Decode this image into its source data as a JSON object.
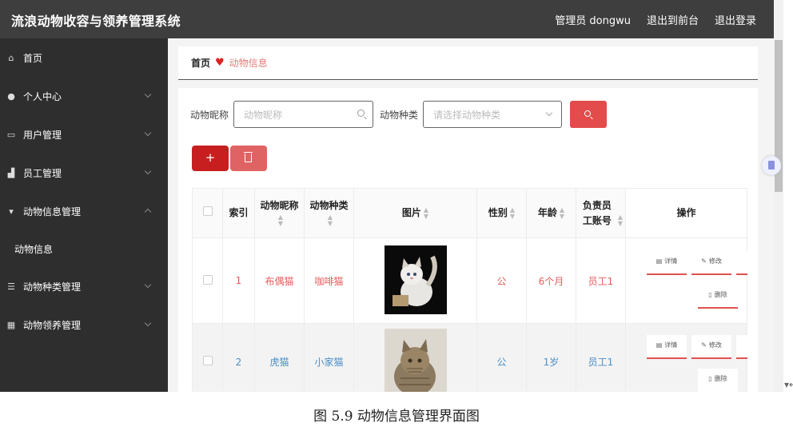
{
  "app": {
    "title": "流浪动物收容与领养管理系统"
  },
  "topbar": {
    "admin": "管理员 dongwu",
    "front": "退出到前台",
    "logout": "退出登录"
  },
  "sidebar": {
    "items": [
      {
        "icon": "home-icon",
        "label": "首页"
      },
      {
        "icon": "user-icon",
        "label": "个人中心"
      },
      {
        "icon": "user-manage-icon",
        "label": "用户管理"
      },
      {
        "icon": "staff-icon",
        "label": "员工管理"
      },
      {
        "icon": "animal-info-icon",
        "label": "动物信息管理"
      },
      {
        "icon": "",
        "label": "动物信息"
      },
      {
        "icon": "category-icon",
        "label": "动物种类管理"
      },
      {
        "icon": "grid-icon",
        "label": "动物领养管理"
      }
    ]
  },
  "breadcrumb": {
    "home": "首页",
    "current": "动物信息"
  },
  "search": {
    "name_label": "动物昵称",
    "name_placeholder": "动物昵称",
    "type_label": "动物种类",
    "type_placeholder": "请选择动物种类"
  },
  "actions": {
    "add": "+"
  },
  "table": {
    "headers": {
      "index": "索引",
      "nickname": "动物昵称",
      "type": "动物种类",
      "image": "图片",
      "gender": "性别",
      "age": "年龄",
      "staff": "负责员工账号",
      "ops": "操作"
    },
    "rows": [
      {
        "index": "1",
        "nickname": "布偶猫",
        "type": "咖啡猫",
        "image": "白色布偶猫照片",
        "gender": "公",
        "age": "6个月",
        "staff": "员工1"
      },
      {
        "index": "2",
        "nickname": "虎猫",
        "type": "小家猫",
        "image": "虎斑猫照片",
        "gender": "公",
        "age": "1岁",
        "staff": "员工1"
      }
    ],
    "op_labels": {
      "detail": "详情",
      "edit": "修改",
      "delete": "删除"
    }
  },
  "caption": "图 5.9 动物信息管理界面图"
}
